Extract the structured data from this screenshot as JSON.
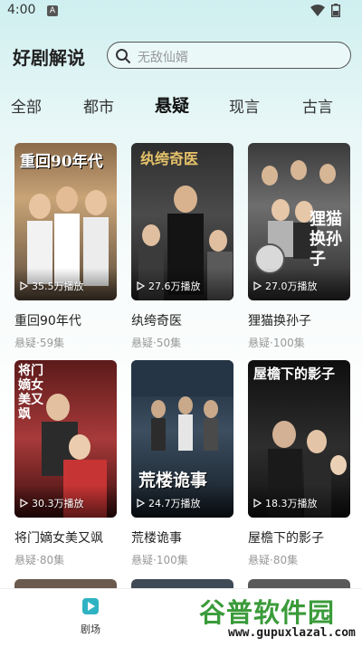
{
  "status_bar": {
    "time": "4:00",
    "notification": "A"
  },
  "header": {
    "app_title": "好剧解说",
    "search_placeholder": "无敌仙婿"
  },
  "tabs": [
    {
      "label": "全部",
      "active": false
    },
    {
      "label": "都市",
      "active": false
    },
    {
      "label": "悬疑",
      "active": true
    },
    {
      "label": "现言",
      "active": false
    },
    {
      "label": "古言",
      "active": false
    }
  ],
  "dramas": [
    {
      "title": "重回90年代",
      "meta": "悬疑·59集",
      "plays": "35.5万播放",
      "poster_text": "重回90年代"
    },
    {
      "title": "纨绔奇医",
      "meta": "悬疑·50集",
      "plays": "27.6万播放",
      "poster_text": "纨绔奇医"
    },
    {
      "title": "狸猫换孙子",
      "meta": "悬疑·100集",
      "plays": "27.0万播放",
      "poster_text": "狸猫换孙子"
    },
    {
      "title": "将门嫡女美又飒",
      "meta": "悬疑·80集",
      "plays": "30.3万播放",
      "poster_text": "将门嫡女美又飒"
    },
    {
      "title": "荒楼诡事",
      "meta": "悬疑·100集",
      "plays": "24.7万播放",
      "poster_text": "荒楼诡事"
    },
    {
      "title": "屋檐下的影子",
      "meta": "悬疑·80集",
      "plays": "18.3万播放",
      "poster_text": "屋檐下的影子"
    }
  ],
  "bottom_nav": {
    "label": "剧场",
    "icon": "theater-icon"
  },
  "watermark": {
    "main": "谷普软件园",
    "url": "www.gupuxlazal.com"
  },
  "colors": {
    "accent": "#34b3c0",
    "watermark_green": "#3a9b3a"
  }
}
